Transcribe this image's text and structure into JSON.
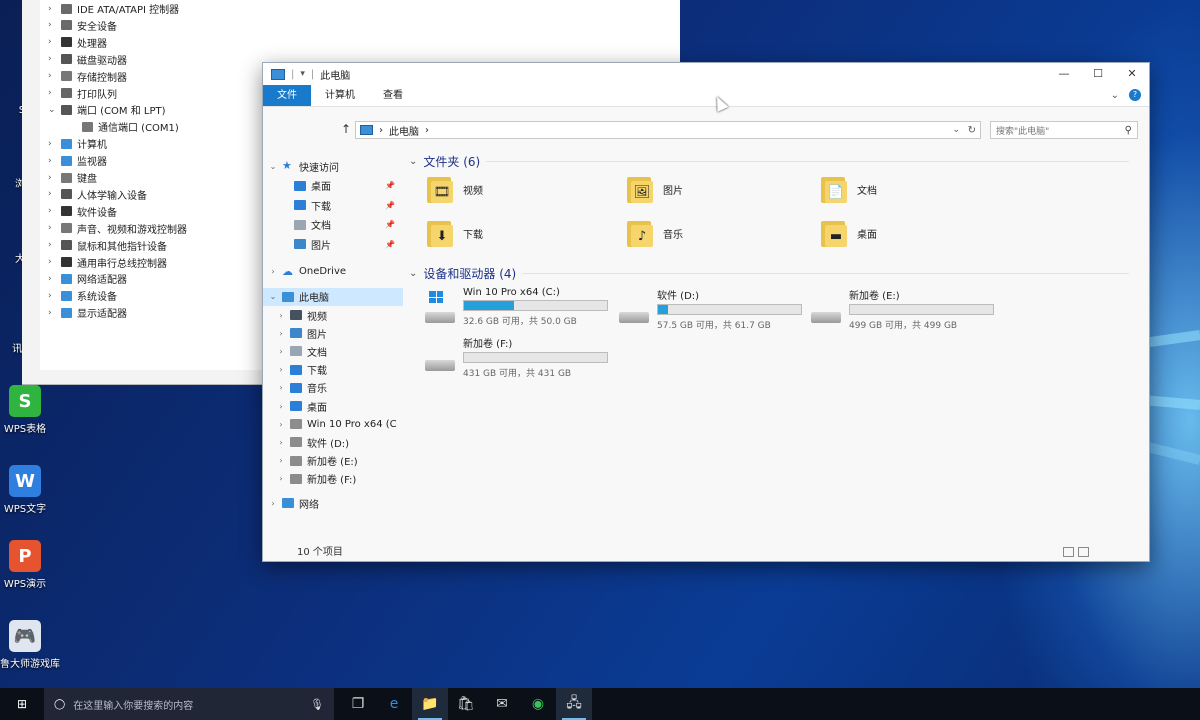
{
  "desktop": {
    "icons": [
      {
        "label": "ST"
      },
      {
        "label": "浏览"
      },
      {
        "label": "大师"
      },
      {
        "label": "讯QQ"
      },
      {
        "label": "WPS表格",
        "color": "#2fb53f",
        "glyph": "S"
      },
      {
        "label": "WPS文字",
        "color": "#2f7fe0",
        "glyph": "W"
      },
      {
        "label": "WPS演示",
        "color": "#e5532f",
        "glyph": "P"
      },
      {
        "label": "鲁大师游戏库",
        "color": "#dfe6ef",
        "glyph": "🎮"
      }
    ]
  },
  "device_manager": {
    "items": [
      {
        "label": "IDE ATA/ATAPI 控制器",
        "expanded": false,
        "level": 0
      },
      {
        "label": "安全设备",
        "expanded": false,
        "level": 0
      },
      {
        "label": "处理器",
        "expanded": false,
        "level": 0
      },
      {
        "label": "磁盘驱动器",
        "expanded": false,
        "level": 0
      },
      {
        "label": "存储控制器",
        "expanded": false,
        "level": 0
      },
      {
        "label": "打印队列",
        "expanded": false,
        "level": 0
      },
      {
        "label": "端口 (COM 和 LPT)",
        "expanded": true,
        "level": 0
      },
      {
        "label": "通信端口 (COM1)",
        "expanded": false,
        "level": 1
      },
      {
        "label": "计算机",
        "expanded": false,
        "level": 0
      },
      {
        "label": "监视器",
        "expanded": false,
        "level": 0
      },
      {
        "label": "键盘",
        "expanded": false,
        "level": 0
      },
      {
        "label": "人体学输入设备",
        "expanded": false,
        "level": 0
      },
      {
        "label": "软件设备",
        "expanded": false,
        "level": 0
      },
      {
        "label": "声音、视频和游戏控制器",
        "expanded": false,
        "level": 0
      },
      {
        "label": "鼠标和其他指针设备",
        "expanded": false,
        "level": 0
      },
      {
        "label": "通用串行总线控制器",
        "expanded": false,
        "level": 0
      },
      {
        "label": "网络适配器",
        "expanded": false,
        "level": 0
      },
      {
        "label": "系统设备",
        "expanded": false,
        "level": 0
      },
      {
        "label": "显示适配器",
        "expanded": false,
        "level": 0
      }
    ]
  },
  "explorer": {
    "title": "此电脑",
    "quick_access_divider": "|",
    "quick_access_arrow": "▾",
    "ribbon": {
      "tabs": [
        {
          "label": "文件",
          "active": true
        },
        {
          "label": "计算机",
          "active": false
        },
        {
          "label": "查看",
          "active": false
        }
      ],
      "expand_glyph": "⌄",
      "help_glyph": "?"
    },
    "window_controls": {
      "minimize": "—",
      "maximize": "☐",
      "close": "✕"
    },
    "address": {
      "up_glyph": "↑",
      "path_prefix": "›",
      "path": "此电脑",
      "path_suffix": "›",
      "dropdown_glyph": "⌄",
      "refresh_glyph": "↻"
    },
    "search": {
      "placeholder": "搜索\"此电脑\"",
      "icon_glyph": "⚲"
    },
    "nav": {
      "quick_access": "快速访问",
      "pinned": [
        {
          "label": "桌面",
          "color": "#2b7fd6"
        },
        {
          "label": "下载",
          "color": "#2b7fd6"
        },
        {
          "label": "文档",
          "color": "#9aa6b4"
        },
        {
          "label": "图片",
          "color": "#3d86c9"
        }
      ],
      "pin_glyph": "📌",
      "onedrive": "OneDrive",
      "this_pc": "此电脑",
      "this_pc_children": [
        {
          "label": "视频",
          "color": "#44515e"
        },
        {
          "label": "图片",
          "color": "#3d86c9"
        },
        {
          "label": "文档",
          "color": "#9aa6b4"
        },
        {
          "label": "下载",
          "color": "#2b7fd6"
        },
        {
          "label": "音乐",
          "color": "#2b7fd6"
        },
        {
          "label": "桌面",
          "color": "#2b7fd6"
        },
        {
          "label": "Win 10 Pro x64 (C",
          "color": "#8c8c8c"
        },
        {
          "label": "软件 (D:)",
          "color": "#8c8c8c"
        },
        {
          "label": "新加卷 (E:)",
          "color": "#8c8c8c"
        },
        {
          "label": "新加卷 (F:)",
          "color": "#8c8c8c"
        }
      ],
      "network": "网络"
    },
    "folders_group": {
      "title": "文件夹 (6)",
      "collapse_glyph": "⌄"
    },
    "folders": [
      {
        "label": "视频",
        "glyph": "🎞"
      },
      {
        "label": "图片",
        "glyph": "🖼"
      },
      {
        "label": "文档",
        "glyph": "📄"
      },
      {
        "label": "下载",
        "glyph": "⬇"
      },
      {
        "label": "音乐",
        "glyph": "♪"
      },
      {
        "label": "桌面",
        "glyph": "▬"
      }
    ],
    "drives_group": {
      "title": "设备和驱动器 (4)",
      "collapse_glyph": "⌄"
    },
    "drives": [
      {
        "name": "Win 10 Pro x64 (C:)",
        "free_text": "32.6 GB 可用，共 50.0 GB",
        "used_fraction": 0.348,
        "system": true
      },
      {
        "name": "软件 (D:)",
        "free_text": "57.5 GB 可用，共 61.7 GB",
        "used_fraction": 0.068,
        "system": false
      },
      {
        "name": "新加卷 (E:)",
        "free_text": "499 GB 可用，共 499 GB",
        "used_fraction": 0.0,
        "system": false
      },
      {
        "name": "新加卷 (F:)",
        "free_text": "431 GB 可用，共 431 GB",
        "used_fraction": 0.0,
        "system": false
      }
    ],
    "status": "10 个项目"
  },
  "taskbar": {
    "start_glyph": "⊞",
    "search_placeholder": "在这里输入你要搜索的内容",
    "search_icon_glyph": "◯",
    "mic_glyph": "🎙",
    "apps": [
      {
        "name": "task-view",
        "glyph": "❐",
        "active": false
      },
      {
        "name": "edge",
        "glyph": "e",
        "active": false
      },
      {
        "name": "file-explorer",
        "glyph": "📁",
        "active": true
      },
      {
        "name": "store",
        "glyph": "🛍",
        "active": false
      },
      {
        "name": "mail",
        "glyph": "✉",
        "active": false
      },
      {
        "name": "browser",
        "glyph": "◉",
        "active": false
      },
      {
        "name": "device-app",
        "glyph": "🖧",
        "active": true
      }
    ]
  }
}
